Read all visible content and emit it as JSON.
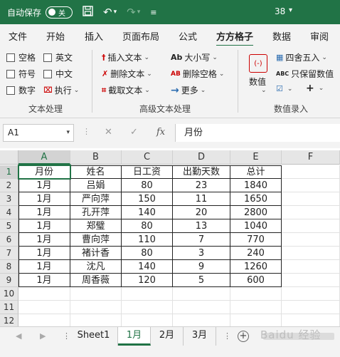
{
  "titlebar": {
    "autosave_label": "自动保存",
    "toggle_text": "关",
    "number": "38",
    "caret": "⌄"
  },
  "tabs": [
    "文件",
    "开始",
    "插入",
    "页面布局",
    "公式",
    "方方格子",
    "数据",
    "审阅"
  ],
  "ribbon": {
    "text_group": {
      "label": "文本处理",
      "checks": [
        "空格",
        "英文",
        "符号",
        "中文",
        "数字"
      ],
      "execute": "执行"
    },
    "advanced_group": {
      "label": "高级文本处理",
      "items": [
        "插入文本",
        "删除文本",
        "截取文本",
        "大小写",
        "删除空格",
        "更多"
      ]
    },
    "number_group": {
      "label": "数值录入",
      "big": "数值",
      "items": [
        "四舍五入",
        "只保留数值"
      ]
    }
  },
  "formula_bar": {
    "name_box": "A1",
    "content": "月份"
  },
  "columns": [
    "A",
    "B",
    "C",
    "D",
    "E",
    "F"
  ],
  "rows": [
    "1",
    "2",
    "3",
    "4",
    "5",
    "6",
    "7",
    "8",
    "9",
    "10",
    "11",
    "12"
  ],
  "table": {
    "headers": [
      "月份",
      "姓名",
      "日工资",
      "出勤天数",
      "总计"
    ],
    "rows": [
      [
        "1月",
        "吕娟",
        "80",
        "23",
        "1840"
      ],
      [
        "1月",
        "严向萍",
        "150",
        "11",
        "1650"
      ],
      [
        "1月",
        "孔开萍",
        "140",
        "20",
        "2800"
      ],
      [
        "1月",
        "郑璧",
        "80",
        "13",
        "1040"
      ],
      [
        "1月",
        "曹向萍",
        "110",
        "7",
        "770"
      ],
      [
        "1月",
        "褚计香",
        "80",
        "3",
        "240"
      ],
      [
        "1月",
        "沈凡",
        "140",
        "9",
        "1260"
      ],
      [
        "1月",
        "周香薇",
        "120",
        "5",
        "600"
      ]
    ]
  },
  "sheets": [
    "Sheet1",
    "1月",
    "2月",
    "3月"
  ],
  "active_sheet": "1月",
  "watermark": "Baidu 经验",
  "colors": {
    "brand": "#217346"
  }
}
